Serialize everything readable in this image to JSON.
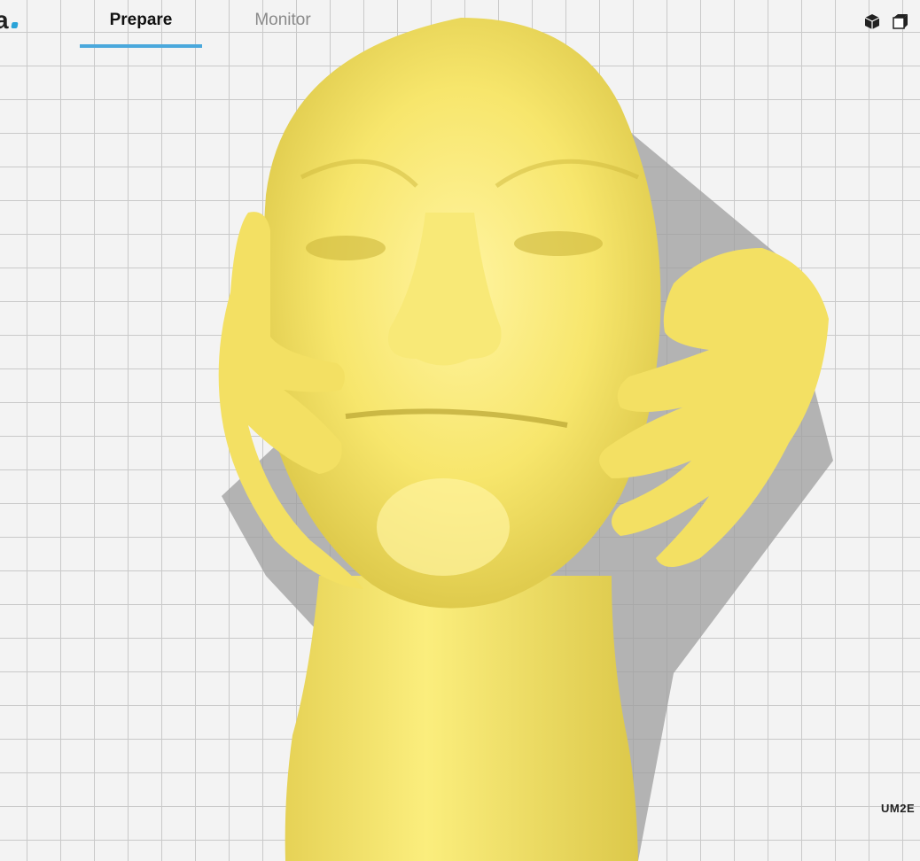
{
  "app": {
    "logo_letter": "a",
    "accent_color": "#2aa3d8"
  },
  "tabs": [
    {
      "label": "Prepare",
      "active": true
    },
    {
      "label": "Monitor",
      "active": false
    }
  ],
  "view_icons": [
    "3d-view-icon",
    "front-view-icon"
  ],
  "printer": {
    "name": "UM2E"
  },
  "model": {
    "color": "#fbee7d",
    "name": "head-with-hands-model"
  }
}
